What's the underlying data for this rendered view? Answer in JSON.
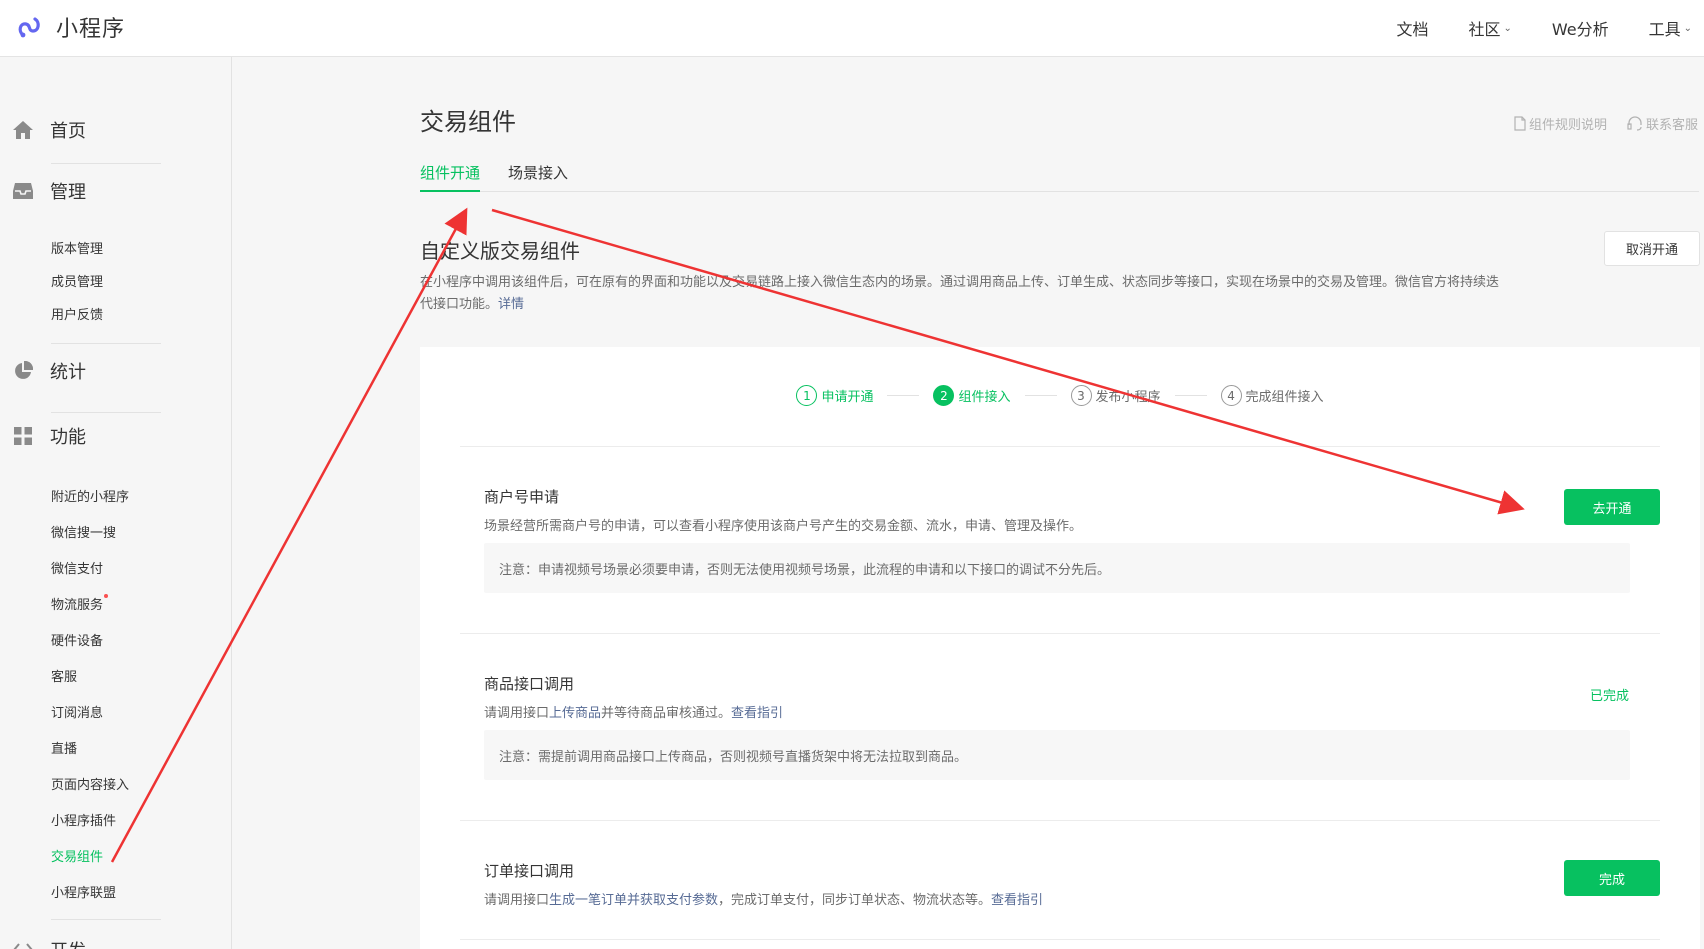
{
  "app": {
    "title": "小程序"
  },
  "topnav": {
    "items": [
      {
        "label": "文档"
      },
      {
        "label": "社区"
      },
      {
        "label": "We分析"
      },
      {
        "label": "工具"
      }
    ]
  },
  "sidebar": {
    "home": "首页",
    "manage": {
      "label": "管理",
      "items": [
        "版本管理",
        "成员管理",
        "用户反馈"
      ]
    },
    "stats": "统计",
    "features": {
      "label": "功能",
      "items": [
        "附近的小程序",
        "微信搜一搜",
        "微信支付",
        "物流服务",
        "硬件设备",
        "客服",
        "订阅消息",
        "直播",
        "页面内容接入",
        "小程序插件",
        "交易组件",
        "小程序联盟"
      ]
    },
    "dev": "开发"
  },
  "page": {
    "title": "交易组件",
    "help_rules": "组件规则说明",
    "help_contact": "联系客服",
    "tabs": [
      "组件开通",
      "场景接入"
    ],
    "section_title": "自定义版交易组件",
    "cancel_button": "取消开通",
    "desc_text": "在小程序中调用该组件后，可在原有的界面和功能以及交易链路上接入微信生态内的场景。通过调用商品上传、订单生成、状态同步等接口，实现在场景中的交易及管理。微信官方将持续迭代接口功能。",
    "desc_link": "详情"
  },
  "steps": [
    {
      "num": "1",
      "label": "申请开通"
    },
    {
      "num": "2",
      "label": "组件接入"
    },
    {
      "num": "3",
      "label": "发布小程序"
    },
    {
      "num": "4",
      "label": "完成组件接入"
    }
  ],
  "blocks": {
    "merchant": {
      "title": "商户号申请",
      "desc": "场景经营所需商户号的申请，可以查看小程序使用该商户号产生的交易金额、流水，申请、管理及操作。",
      "note": "注意：申请视频号场景必须要申请，否则无法使用视频号场景，此流程的申请和以下接口的调试不分先后。",
      "button": "去开通"
    },
    "product": {
      "title": "商品接口调用",
      "desc_pre": "请调用接口",
      "desc_link1": "上传商品",
      "desc_mid": "并等待商品审核通过。",
      "desc_link2": "查看指引",
      "note": "注意：需提前调用商品接口上传商品，否则视频号直播货架中将无法拉取到商品。",
      "status": "已完成"
    },
    "order": {
      "title": "订单接口调用",
      "desc_pre": "请调用接口",
      "desc_link1": "生成一笔订单并获取支付参数",
      "desc_mid": "，完成订单支付，同步订单状态、物流状态等。",
      "desc_link2": "查看指引",
      "button": "完成"
    }
  },
  "colors": {
    "accent": "#07c160",
    "link": "#576b95",
    "annotation": "#ee3333"
  }
}
